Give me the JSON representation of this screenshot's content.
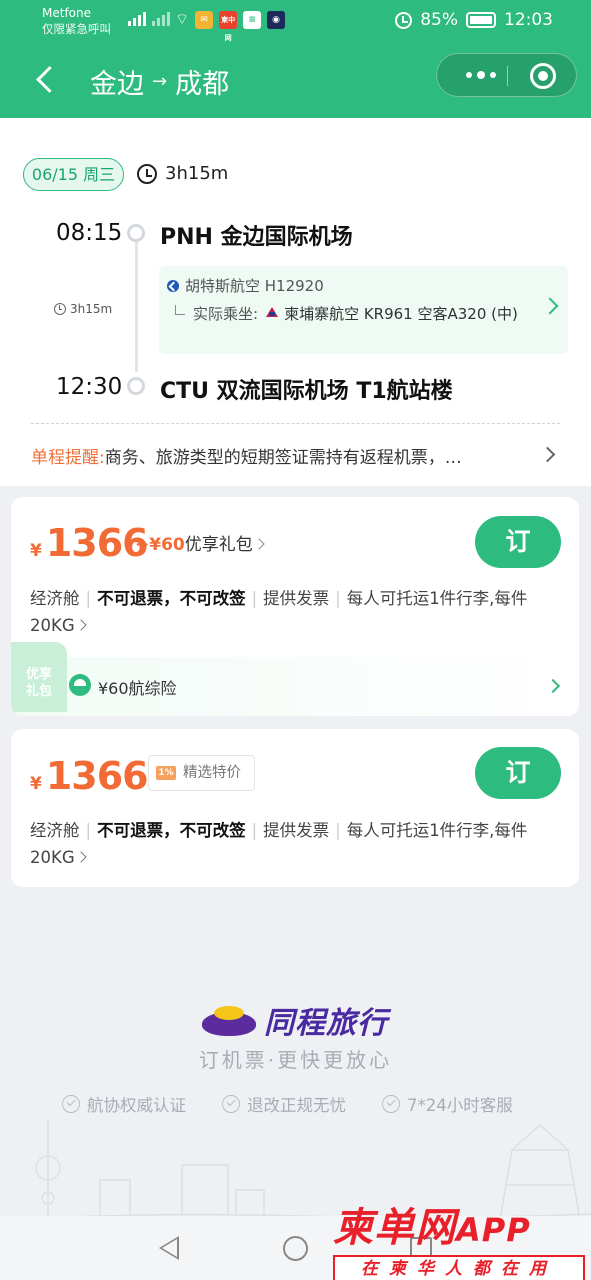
{
  "status_bar": {
    "carrier": "Metfone",
    "carrier_sub": "仅限紧急呼叫",
    "app_icons": [
      "mail-app",
      "柬中网",
      "message-app",
      "camera-app"
    ],
    "battery": "85%",
    "time": "12:03"
  },
  "header": {
    "origin": "金边",
    "arrow": "→",
    "destination": "成都"
  },
  "flight": {
    "date": "06/15 周三",
    "duration": "3h15m",
    "depart_time": "08:15",
    "depart_airport": "PNH 金边国际机场",
    "mid_duration": "3h15m",
    "marketing": "胡特斯航空 H12920",
    "actual_label": "实际乘坐:",
    "actual_flight": "柬埔寨航空 KR961 空客A320 (中)",
    "arrive_time": "12:30",
    "arrive_airport": "CTU 双流国际机场 T1航站楼",
    "notice_label": "单程提醒:",
    "notice_text": "商务、旅游类型的短期签证需持有返程机票，…"
  },
  "fares": [
    {
      "currency": "¥",
      "price": "1366",
      "gift_amount": "+¥60",
      "gift_label": "优享礼包",
      "book_label": "订",
      "cabin": "经济舱",
      "refund": "不可退票，不可改签",
      "invoice": "提供发票",
      "baggage": "每人可托运1件行李,每件20KG",
      "badge": "优享礼包",
      "insurance": "¥60航综险"
    },
    {
      "currency": "¥",
      "price": "1366",
      "tag": "精选特价",
      "tag_icon": "1%",
      "book_label": "订",
      "cabin": "经济舱",
      "refund": "不可退票，不可改签",
      "invoice": "提供发票",
      "baggage": "每人可托运1件行李,每件20KG"
    }
  ],
  "footer": {
    "brand": "同程旅行",
    "slogan": "订机票·更快更放心",
    "promises": [
      "航协权威认证",
      "退改正规无忧",
      "7*24小时客服"
    ]
  },
  "watermark": {
    "main": "柬单网",
    "main_suffix": "APP",
    "sub": "在柬华人都在用"
  },
  "colors": {
    "brand_green": "#2dbb7f",
    "price_orange": "#f26a34",
    "background": "#eff0f4"
  }
}
